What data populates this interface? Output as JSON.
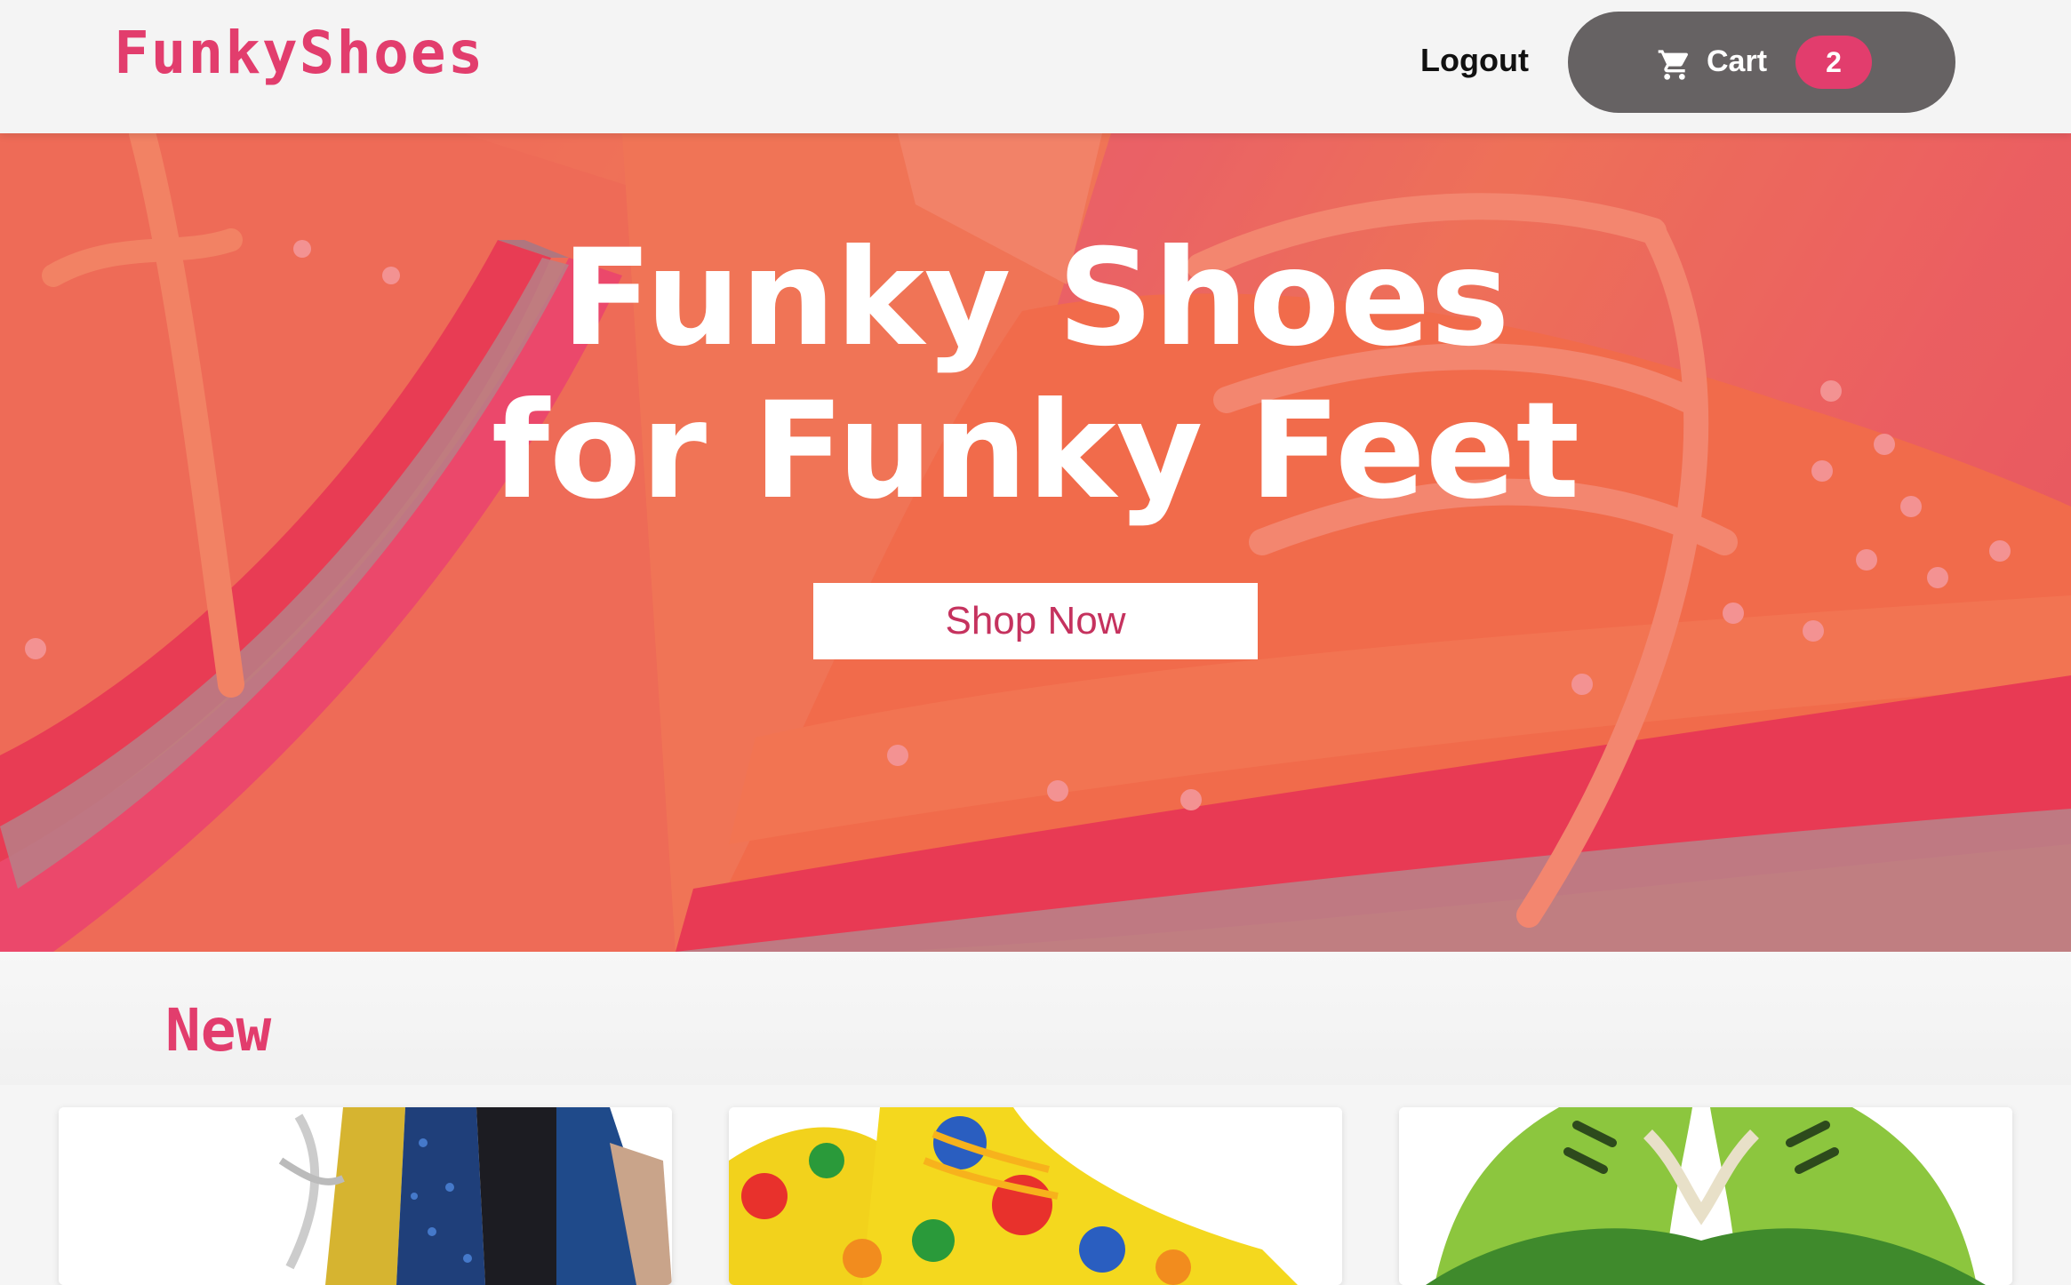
{
  "header": {
    "logo": "FunkyShoes",
    "logout_label": "Logout",
    "cart_label": "Cart",
    "cart_count": "2",
    "cart_icon": "shopping-cart-icon"
  },
  "hero": {
    "title_line1": "Funky Shoes",
    "title_line2": "for Funky Feet",
    "cta_label": "Shop Now"
  },
  "new_section": {
    "title": "New",
    "products": [
      {
        "image": "glitter-boot"
      },
      {
        "image": "polka-dot-clown-shoes"
      },
      {
        "image": "green-dinosaur-sneakers"
      }
    ]
  },
  "colors": {
    "brand": "#e23d6d",
    "cart_button": "#666263",
    "header_bg": "#f4f4f4"
  }
}
